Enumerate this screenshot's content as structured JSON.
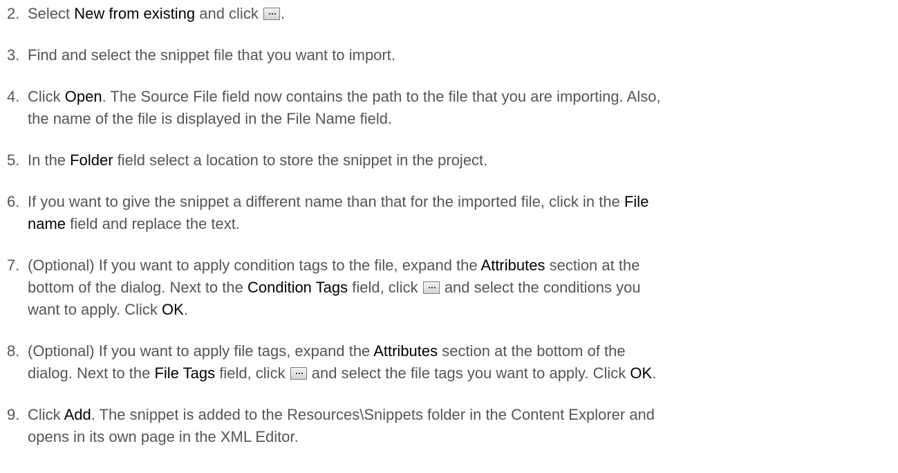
{
  "steps": [
    {
      "number": "2.",
      "parts": [
        "Select ",
        "New from existing",
        " and click ",
        "."
      ]
    },
    {
      "number": "3.",
      "text": "Find and select the snippet file that you want to import."
    },
    {
      "number": "4.",
      "line1": [
        "Click ",
        "Open",
        ". The Source File field now contains the path to the file that you are importing. Also,"
      ],
      "line2": "the name of the file is displayed in the File Name field."
    },
    {
      "number": "5.",
      "parts": [
        "In the ",
        "Folder",
        " field select a location to store the snippet in the project."
      ]
    },
    {
      "number": "6.",
      "line1": [
        "If you want to give the snippet a different name than that for the imported file, click in the ",
        "File"
      ],
      "line2": [
        "name",
        " field and replace the text."
      ]
    },
    {
      "number": "7.",
      "line1": [
        "(Optional) If you want to apply condition tags to the file, expand the ",
        "Attributes",
        " section at the"
      ],
      "line2": [
        "bottom of the dialog. Next to the ",
        "Condition Tags",
        " field, click ",
        " and select the conditions you"
      ],
      "line3": [
        "want to apply. Click ",
        "OK",
        "."
      ]
    },
    {
      "number": "8.",
      "line1": [
        "(Optional) If you want to apply file tags, expand the ",
        "Attributes",
        " section at the bottom of the"
      ],
      "line2": [
        "dialog. Next to the ",
        "File Tags",
        " field, click ",
        " and select the file tags you want to apply. Click ",
        "OK",
        "."
      ]
    },
    {
      "number": "9.",
      "line1": [
        "Click ",
        "Add",
        ". The snippet is added to the Resources\\Snippets folder in the Content Explorer and"
      ],
      "line2": "opens in its own page in the XML Editor."
    }
  ],
  "icons": {
    "browse": "ellipsis-browse-button-icon"
  },
  "colors": {
    "text": "#555555",
    "emphasis": "#000000"
  }
}
